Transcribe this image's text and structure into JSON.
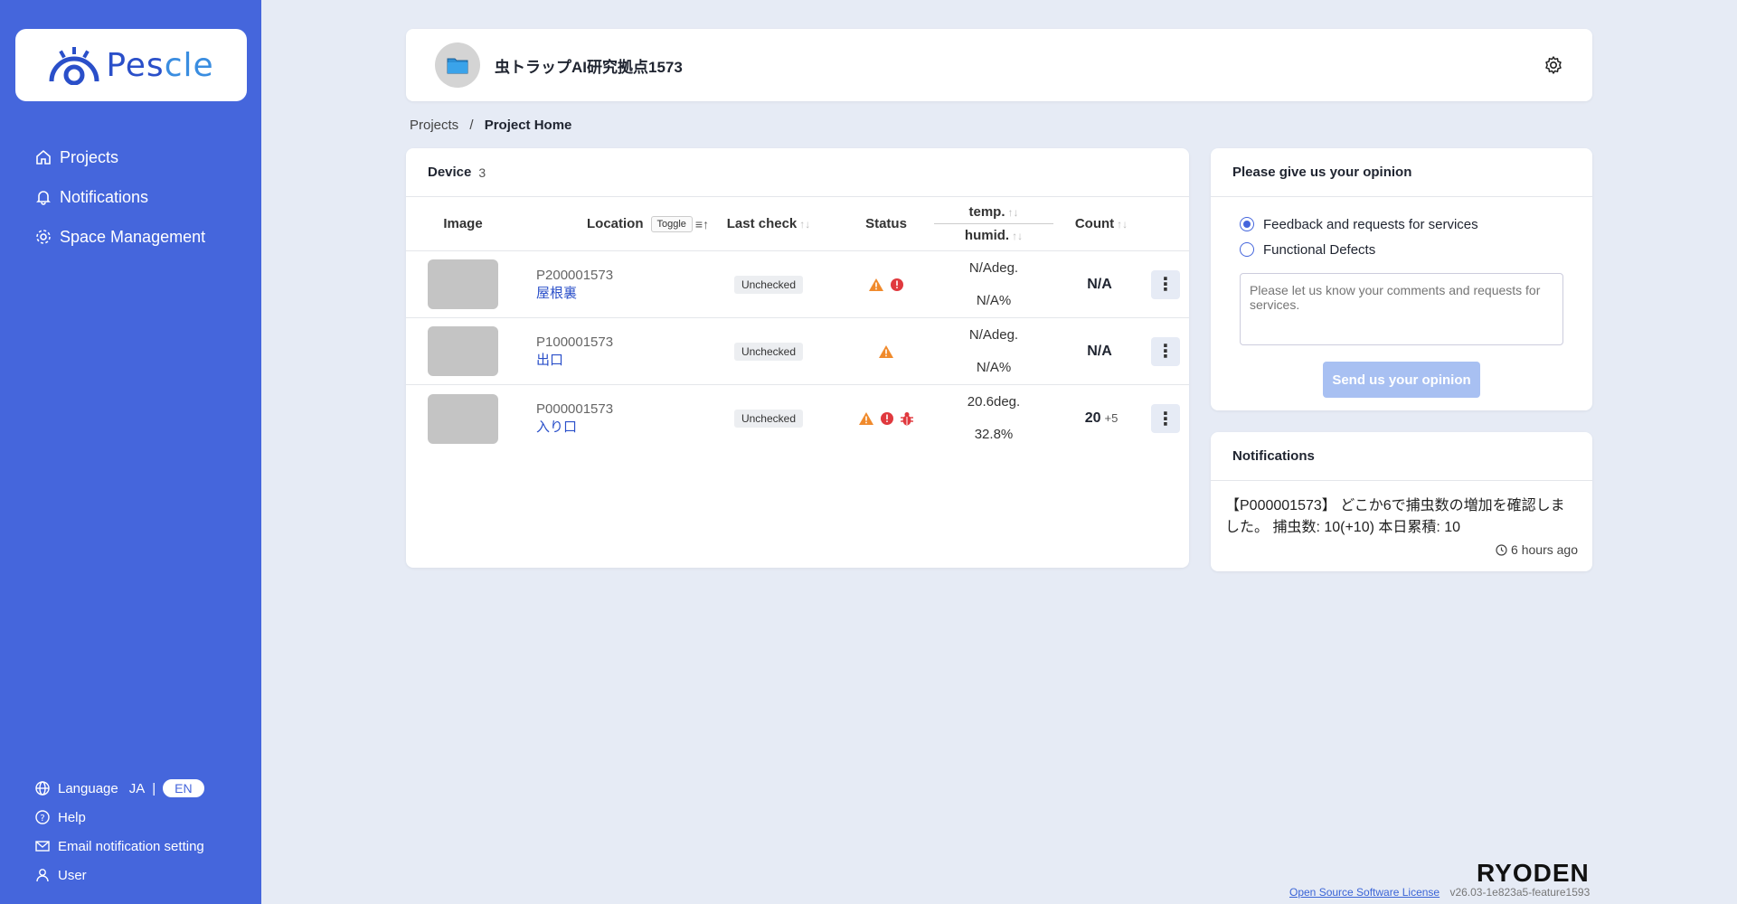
{
  "brand": {
    "name_part1": "Pes",
    "name_part2": "cle"
  },
  "sidebar": {
    "items": [
      {
        "label": "Projects",
        "icon": "home-icon"
      },
      {
        "label": "Notifications",
        "icon": "bell-icon"
      },
      {
        "label": "Space Management",
        "icon": "gear-icon"
      }
    ],
    "bottom": {
      "language_label": "Language",
      "lang_ja": "JA",
      "lang_sep": "|",
      "lang_en": "EN",
      "help": "Help",
      "email_setting": "Email notification setting",
      "user": "User"
    }
  },
  "header": {
    "title": "虫トラップAI研究拠点1573"
  },
  "breadcrumb": {
    "root": "Projects",
    "sep": "/",
    "current": "Project Home"
  },
  "device": {
    "title": "Device",
    "count": "3",
    "columns": {
      "image": "Image",
      "location": "Location",
      "toggle": "Toggle",
      "last_check": "Last check",
      "status": "Status",
      "temp": "temp.",
      "humid": "humid.",
      "count": "Count"
    },
    "rows": [
      {
        "id": "P200001573",
        "name": "屋根裏",
        "check": "Unchecked",
        "status": [
          "warning",
          "error"
        ],
        "temp": "N/Adeg.",
        "humid": "N/A%",
        "count": "N/A",
        "plus": ""
      },
      {
        "id": "P100001573",
        "name": "出口",
        "check": "Unchecked",
        "status": [
          "warning"
        ],
        "temp": "N/Adeg.",
        "humid": "N/A%",
        "count": "N/A",
        "plus": ""
      },
      {
        "id": "P000001573",
        "name": "入り口",
        "check": "Unchecked",
        "status": [
          "warning",
          "error",
          "bug"
        ],
        "temp": "20.6deg.",
        "humid": "32.8%",
        "count": "20",
        "plus": "+5"
      }
    ]
  },
  "opinion": {
    "title": "Please give us your opinion",
    "option1": "Feedback and requests for services",
    "option2": "Functional Defects",
    "placeholder": "Please let us know your comments and requests for services.",
    "send": "Send us your opinion"
  },
  "notifications": {
    "title": "Notifications",
    "message": "【P000001573】 どこか6で捕虫数の増加を確認しました。 捕虫数: 10(+10) 本日累積: 10",
    "time": "6 hours ago"
  },
  "footer": {
    "company": "RYODEN",
    "license": "Open Source Software License",
    "version": "v26.03-1e823a5-feature1593"
  },
  "colors": {
    "sidebar": "#4566dc",
    "warning": "#f08a2c",
    "error": "#e0393e",
    "link": "#2a4fc9"
  }
}
